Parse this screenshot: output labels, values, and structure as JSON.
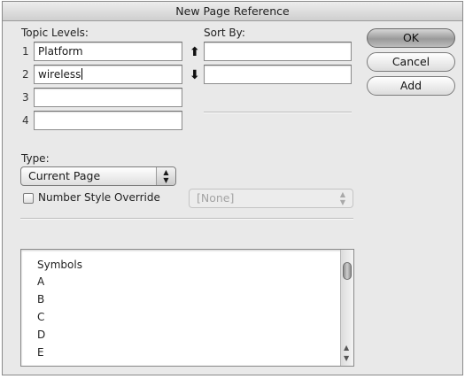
{
  "window": {
    "title": "New Page Reference"
  },
  "topic": {
    "label": "Topic Levels:",
    "levels": [
      {
        "num": "1",
        "value": "Platform"
      },
      {
        "num": "2",
        "value": "wireless"
      },
      {
        "num": "3",
        "value": ""
      },
      {
        "num": "4",
        "value": ""
      }
    ]
  },
  "sort": {
    "label": "Sort By:",
    "values": [
      "",
      ""
    ]
  },
  "arrows": {
    "up": "⬆",
    "down": "⬇"
  },
  "buttons": {
    "ok": "OK",
    "cancel": "Cancel",
    "add": "Add"
  },
  "type": {
    "label": "Type:",
    "selected": "Current Page"
  },
  "override": {
    "label": "Number Style Override",
    "checked": false,
    "selected": "[None]"
  },
  "index_list": {
    "items": [
      "Symbols",
      "A",
      "B",
      "C",
      "D",
      "E"
    ]
  },
  "icons": {
    "spinner": "updown-chevrons-icon",
    "scroll_up": "▲",
    "scroll_down": "▼"
  }
}
